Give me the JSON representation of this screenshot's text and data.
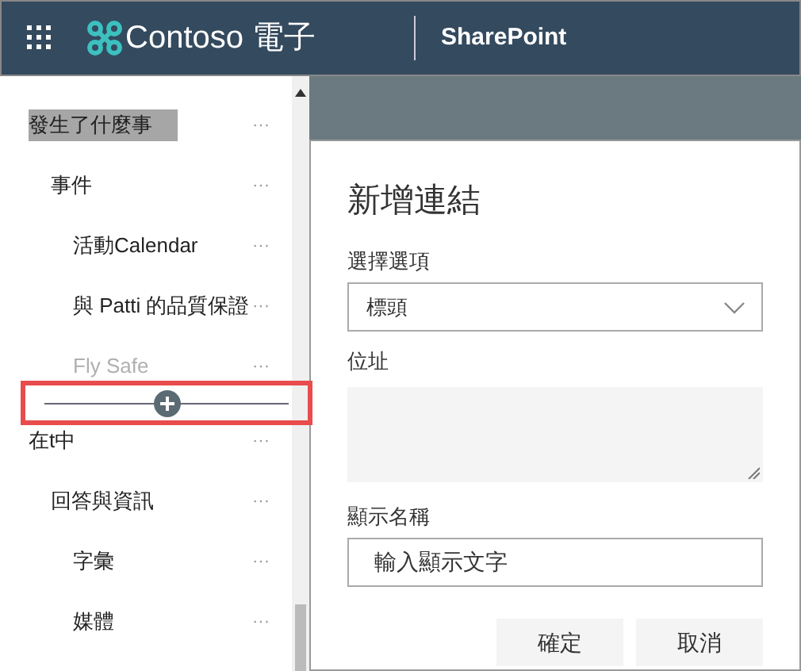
{
  "header": {
    "brand": "Contoso 電子",
    "app": "SharePoint"
  },
  "nav": {
    "items": [
      {
        "label": "發生了什麼事",
        "selected": true,
        "dimmed": false,
        "children": [
          {
            "label": "事件",
            "selected": false,
            "dimmed": false,
            "children": [
              {
                "label": "活動Calendar",
                "selected": false,
                "dimmed": false
              },
              {
                "label": "與 Patti 的品質保證",
                "selected": false,
                "dimmed": false
              },
              {
                "label": "Fly Safe",
                "selected": false,
                "dimmed": true
              }
            ]
          }
        ]
      },
      {
        "label": "在t中",
        "selected": false,
        "dimmed": false,
        "children": [
          {
            "label": "回答與資訊",
            "selected": false,
            "dimmed": false,
            "children": [
              {
                "label": "字彙",
                "selected": false,
                "dimmed": false
              },
              {
                "label": "媒體",
                "selected": false,
                "dimmed": false
              }
            ]
          }
        ]
      }
    ],
    "more": "···"
  },
  "panel": {
    "title": "新增連結",
    "choose_label": "選擇選項",
    "dropdown_value": "標頭",
    "address_label": "位址",
    "display_label": "顯示名稱",
    "display_value": "輸入顯示文字",
    "buttons": [
      "確定",
      "取消"
    ]
  }
}
